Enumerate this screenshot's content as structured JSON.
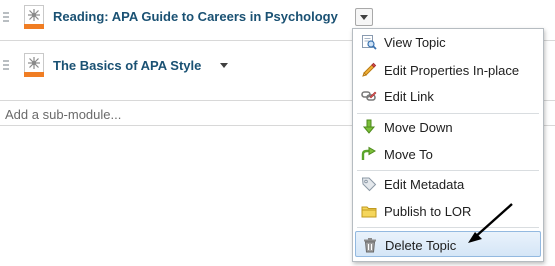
{
  "topics": [
    {
      "title": "Reading: APA Guide to Careers in Psychology",
      "icon": "html-topic-icon"
    },
    {
      "title": "The Basics of APA Style",
      "icon": "html-topic-icon"
    }
  ],
  "add_submodule": {
    "placeholder": "Add a sub-module..."
  },
  "context_menu": {
    "items": [
      {
        "label": "View Topic",
        "icon": "view-icon"
      },
      {
        "label": "Edit Properties In-place",
        "icon": "pencil-icon"
      },
      {
        "label": "Edit Link",
        "icon": "link-icon"
      },
      {
        "label": "Move Down",
        "icon": "arrow-down-icon"
      },
      {
        "label": "Move To",
        "icon": "move-to-icon"
      },
      {
        "label": "Edit Metadata",
        "icon": "tag-icon"
      },
      {
        "label": "Publish to LOR",
        "icon": "folder-icon"
      },
      {
        "label": "Delete Topic",
        "icon": "trash-icon"
      }
    ],
    "highlighted": "Delete Topic"
  },
  "colors": {
    "title": "#1a5173",
    "accent_bar": "#f07d23",
    "highlight": "#d5e6f7"
  }
}
